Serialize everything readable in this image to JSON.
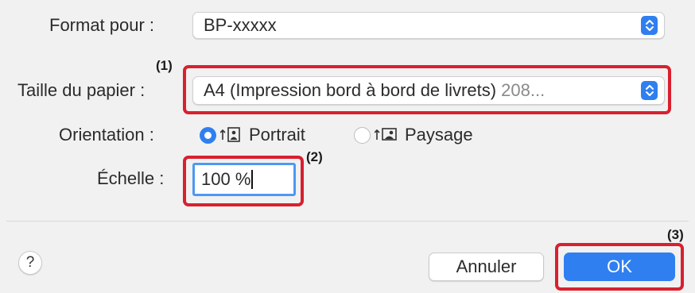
{
  "format_for": {
    "label": "Format pour :",
    "value": "BP-xxxxx"
  },
  "paper_size": {
    "label": "Taille du papier :",
    "value": "A4 (Impression bord à bord de livrets)",
    "value_suffix": " 208..."
  },
  "orientation": {
    "label": "Orientation :",
    "options": [
      {
        "label": "Portrait",
        "selected": true
      },
      {
        "label": "Paysage",
        "selected": false
      }
    ]
  },
  "scale": {
    "label": "Échelle :",
    "value": "100 %"
  },
  "callouts": [
    "(1)",
    "(2)",
    "(3)"
  ],
  "help": {
    "label": "?"
  },
  "buttons": {
    "cancel": "Annuler",
    "ok": "OK"
  },
  "colors": {
    "accent": "#2f7ff0",
    "callout_border": "#d8202f"
  },
  "icons": {
    "popup": "up-down-stepper-icon",
    "portrait": "portrait-orientation-icon",
    "landscape": "landscape-orientation-icon"
  }
}
